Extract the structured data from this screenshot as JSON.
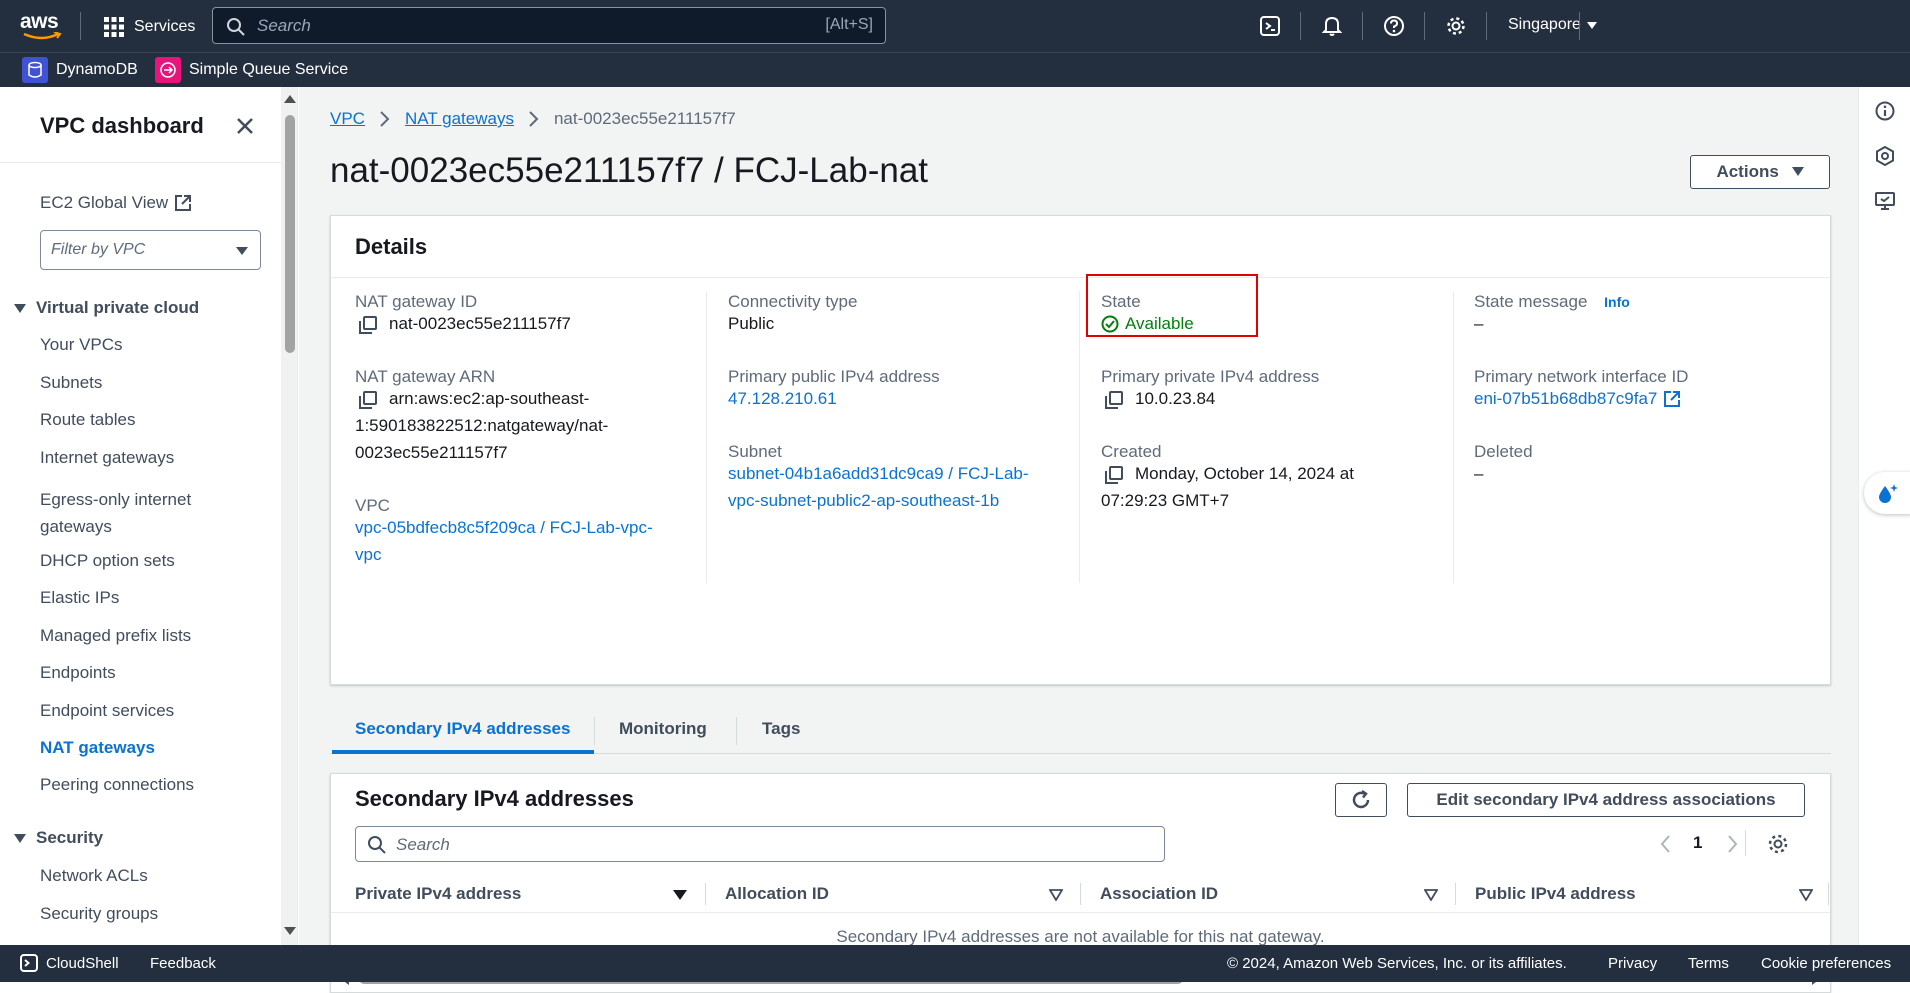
{
  "topbar": {
    "logo": "aws",
    "services_label": "Services",
    "search_placeholder": "Search",
    "search_shortcut": "[Alt+S]",
    "region": "Singapore"
  },
  "favorites": [
    {
      "label": "DynamoDB",
      "color": "#4053d6"
    },
    {
      "label": "Simple Queue Service",
      "color": "#e7157b"
    }
  ],
  "sidebar": {
    "title": "VPC dashboard",
    "global_view": "EC2 Global View",
    "filter_placeholder": "Filter by VPC",
    "section_vpc": "Virtual private cloud",
    "items": [
      "Your VPCs",
      "Subnets",
      "Route tables",
      "Internet gateways",
      "Egress-only internet gateways",
      "DHCP option sets",
      "Elastic IPs",
      "Managed prefix lists",
      "Endpoints",
      "Endpoint services",
      "NAT gateways",
      "Peering connections"
    ],
    "active_item": "NAT gateways",
    "section_security": "Security",
    "security_items": [
      "Network ACLs",
      "Security groups"
    ]
  },
  "breadcrumb": [
    "VPC",
    "NAT gateways",
    "nat-0023ec55e211157f7"
  ],
  "page_title": "nat-0023ec55e211157f7 / FCJ-Lab-nat",
  "actions_label": "Actions",
  "details": {
    "heading": "Details",
    "nat_id_label": "NAT gateway ID",
    "nat_id": "nat-0023ec55e211157f7",
    "nat_arn_label": "NAT gateway ARN",
    "nat_arn_1": "arn:aws:ec2:ap-southeast-",
    "nat_arn_2": "1:590183822512:natgateway/nat-",
    "nat_arn_3": "0023ec55e211157f7",
    "vpc_label": "VPC",
    "vpc_1": "vpc-05bdfecb8c5f209ca / FCJ-Lab-vpc-",
    "vpc_2": "vpc",
    "conn_type_label": "Connectivity type",
    "conn_type": "Public",
    "public_ip_label": "Primary public IPv4 address",
    "public_ip": "47.128.210.61",
    "subnet_label": "Subnet",
    "subnet_1": "subnet-04b1a6add31dc9ca9 / FCJ-Lab-",
    "subnet_2": "vpc-subnet-public2-ap-southeast-1b",
    "state_label": "State",
    "state": "Available",
    "private_ip_label": "Primary private IPv4 address",
    "private_ip": "10.0.23.84",
    "created_label": "Created",
    "created_1": "Monday, October 14, 2024 at",
    "created_2": "07:29:23 GMT+7",
    "state_msg_label": "State message",
    "info_label": "Info",
    "state_msg": "–",
    "eni_label": "Primary network interface ID",
    "eni": "eni-07b51b68db87c9fa7",
    "deleted_label": "Deleted",
    "deleted": "–"
  },
  "tabs": [
    "Secondary IPv4 addresses",
    "Monitoring",
    "Tags"
  ],
  "secondary": {
    "heading": "Secondary IPv4 addresses",
    "edit_label": "Edit secondary IPv4 address associations",
    "search_placeholder": "Search",
    "page": "1",
    "columns": [
      "Private IPv4 address",
      "Allocation ID",
      "Association ID",
      "Public IPv4 address"
    ],
    "empty": "Secondary IPv4 addresses are not available for this nat gateway."
  },
  "footer": {
    "cloudshell": "CloudShell",
    "feedback": "Feedback",
    "copyright": "© 2024, Amazon Web Services, Inc. or its affiliates.",
    "privacy": "Privacy",
    "terms": "Terms",
    "cookies": "Cookie preferences"
  },
  "colors": {
    "nav": "#232f3e",
    "link": "#0972d3",
    "success": "#037f0c",
    "highlight": "#e00000"
  }
}
